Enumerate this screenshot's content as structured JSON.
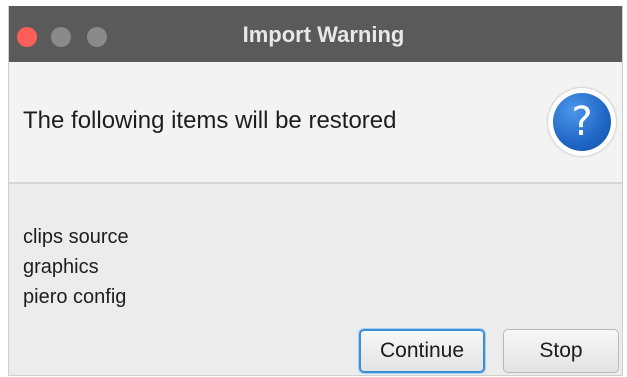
{
  "window": {
    "title": "Import Warning"
  },
  "header": {
    "message": "The following items will be restored",
    "icon": "question-icon"
  },
  "items": [
    "clips source",
    "graphics",
    "piero config"
  ],
  "buttons": {
    "continue_label": "Continue",
    "stop_label": "Stop"
  },
  "colors": {
    "titlebar": "#5a5a5a",
    "close_button": "#ff5f57",
    "accent": "#3a8fd9",
    "icon_blue": "#1f66c6"
  }
}
